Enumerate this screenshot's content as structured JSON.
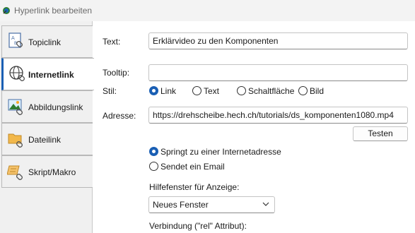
{
  "window": {
    "title": "Hyperlink bearbeiten",
    "app_icon": "edit-hyperlink-icon"
  },
  "sidebar": {
    "tabs": [
      {
        "label": "Topiclink",
        "icon": "document-link-icon",
        "active": false
      },
      {
        "label": "Internetlink",
        "icon": "globe-link-icon",
        "active": true
      },
      {
        "label": "Abbildungslink",
        "icon": "image-link-icon",
        "active": false
      },
      {
        "label": "Dateilink",
        "icon": "folder-link-icon",
        "active": false
      },
      {
        "label": "Skript/Makro",
        "icon": "script-link-icon",
        "active": false
      }
    ]
  },
  "form": {
    "text_label": "Text:",
    "text_value": "Erklärvideo zu den Komponenten",
    "tooltip_label": "Tooltip:",
    "tooltip_value": "",
    "style_label": "Stil:",
    "style_options": [
      {
        "label": "Link",
        "checked": true
      },
      {
        "label": "Text",
        "checked": false
      },
      {
        "label": "Schaltfläche",
        "checked": false
      },
      {
        "label": "Bild",
        "checked": false
      }
    ],
    "address_label": "Adresse:",
    "address_value": "https://drehscheibe.hech.ch/tutorials/ds_komponenten1080.mp4",
    "test_button": "Testen",
    "action_options": [
      {
        "label": "Springt zu einer Internetadresse",
        "checked": true
      },
      {
        "label": "Sendet ein Email",
        "checked": false
      }
    ],
    "help_window_label": "Hilfefenster für Anzeige:",
    "help_window_value": "Neues Fenster",
    "rel_label": "Verbindung (\"rel\" Attribut):"
  },
  "colors": {
    "accent": "#1a5fb4",
    "active_tab_bg": "#ffffff",
    "sidebar_bg": "#f0f0f0"
  }
}
